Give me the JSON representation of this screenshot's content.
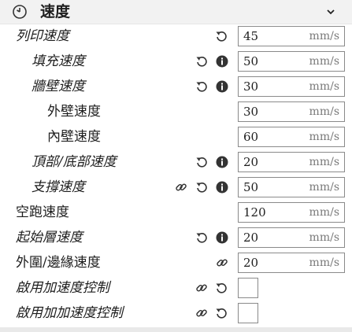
{
  "header": {
    "title": "速度",
    "icon": "clock-icon",
    "collapse_icon": "chevron-down-icon"
  },
  "rows": [
    {
      "id": "print-speed",
      "label": "列印速度",
      "value": "45",
      "unit": "mm/s",
      "icons": [
        "reset-icon"
      ]
    },
    {
      "id": "infill-speed",
      "label": "填充速度",
      "value": "50",
      "unit": "mm/s",
      "icons": [
        "reset-icon",
        "info-icon"
      ]
    },
    {
      "id": "wall-speed",
      "label": "牆壁速度",
      "value": "30",
      "unit": "mm/s",
      "icons": [
        "reset-icon",
        "info-icon"
      ]
    },
    {
      "id": "outer-wall-speed",
      "label": "外壁速度",
      "value": "30",
      "unit": "mm/s",
      "icons": []
    },
    {
      "id": "inner-wall-speed",
      "label": "內壁速度",
      "value": "60",
      "unit": "mm/s",
      "icons": []
    },
    {
      "id": "top-bottom-speed",
      "label": "頂部/底部速度",
      "value": "20",
      "unit": "mm/s",
      "icons": [
        "reset-icon",
        "info-icon"
      ]
    },
    {
      "id": "support-speed",
      "label": "支撐速度",
      "value": "50",
      "unit": "mm/s",
      "icons": [
        "link-icon",
        "reset-icon",
        "info-icon"
      ]
    },
    {
      "id": "travel-speed",
      "label": "空跑速度",
      "value": "120",
      "unit": "mm/s",
      "icons": []
    },
    {
      "id": "initial-layer-speed",
      "label": "起始層速度",
      "value": "20",
      "unit": "mm/s",
      "icons": [
        "reset-icon",
        "info-icon"
      ]
    },
    {
      "id": "skirt-brim-speed",
      "label": "外圍/邊緣速度",
      "value": "20",
      "unit": "mm/s",
      "icons": [
        "link-icon"
      ]
    },
    {
      "id": "enable-acceleration-control",
      "label": "啟用加速度控制",
      "checkbox": true,
      "checked": false,
      "icons": [
        "link-icon",
        "reset-icon"
      ]
    },
    {
      "id": "enable-jerk-control",
      "label": "啟用加加速度控制",
      "checkbox": true,
      "checked": false,
      "icons": [
        "link-icon",
        "reset-icon"
      ]
    }
  ]
}
